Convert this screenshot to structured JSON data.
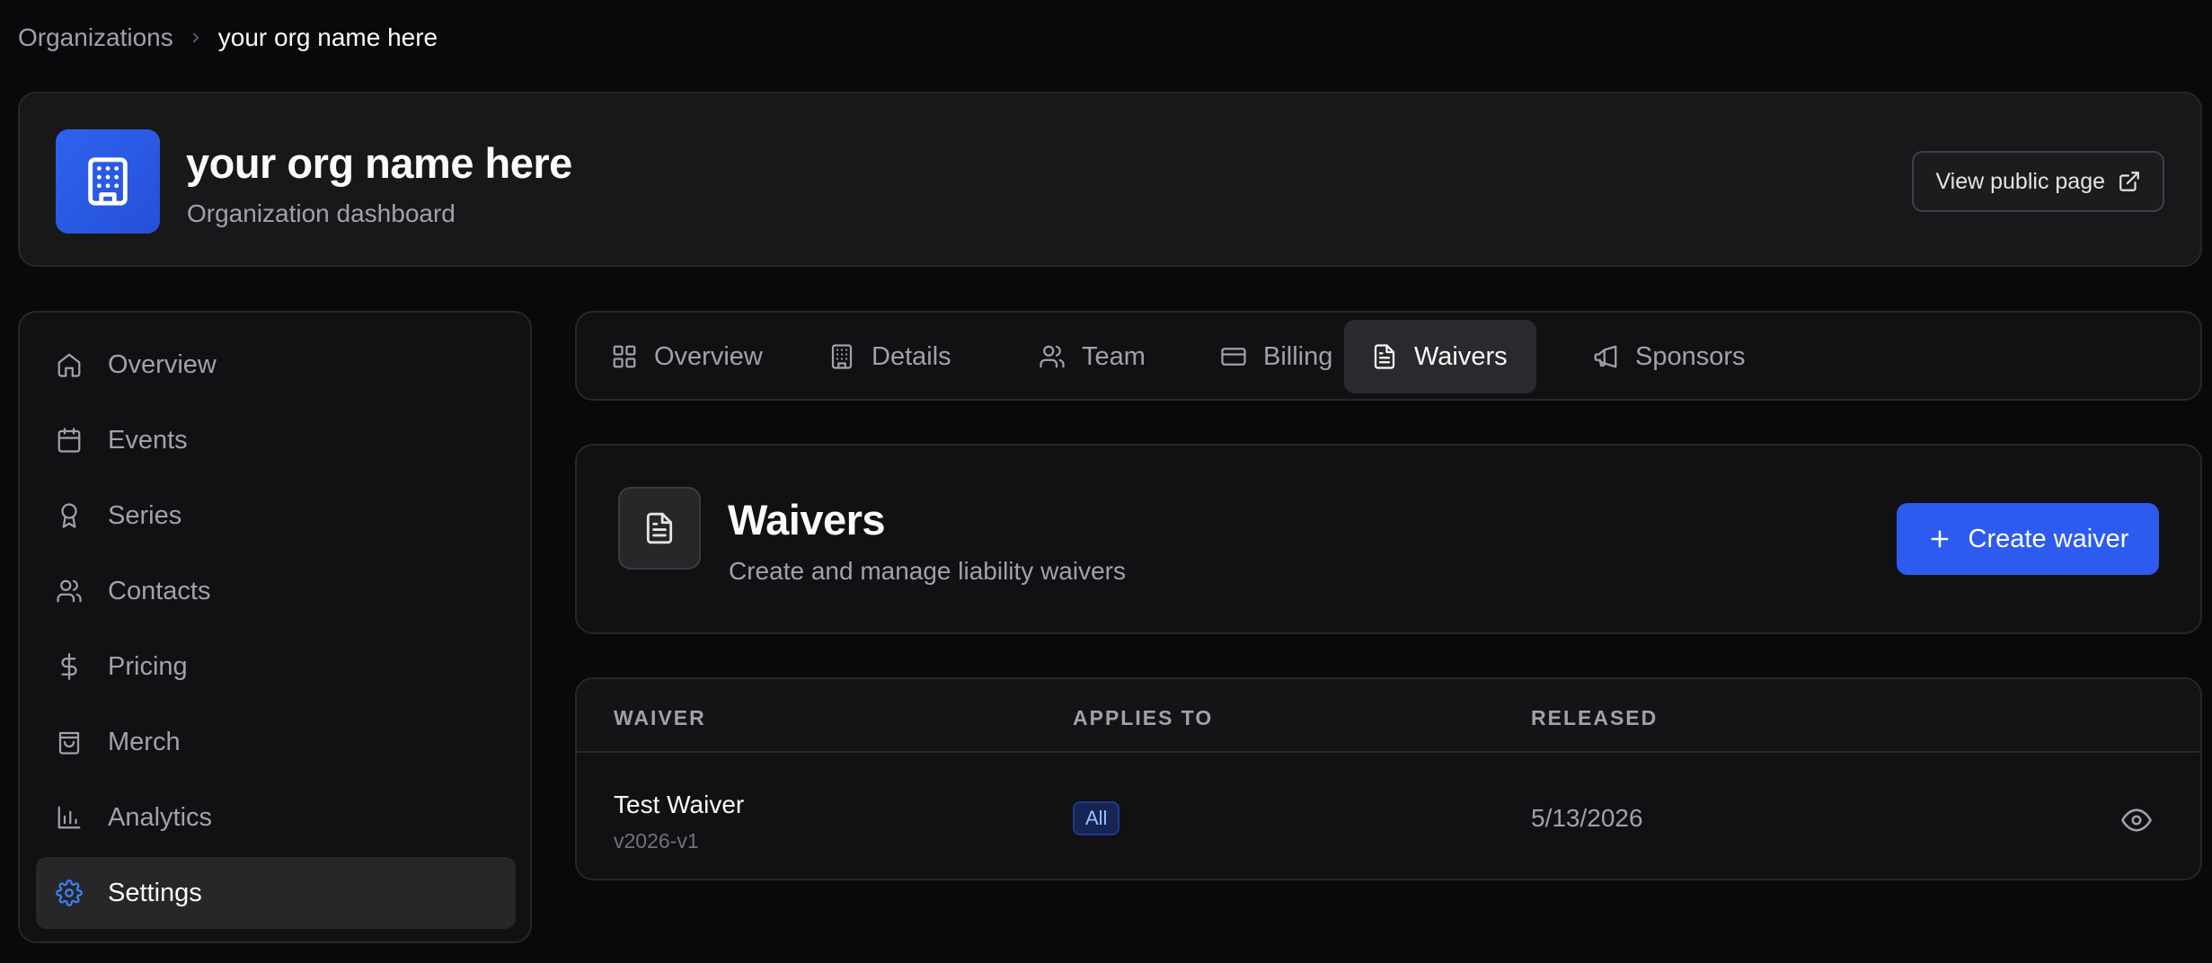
{
  "breadcrumb": {
    "root": "Organizations",
    "current": "your org name here"
  },
  "org": {
    "name": "your org name here",
    "subtitle": "Organization dashboard",
    "public_button": "View public page",
    "logo_icon": "building-icon"
  },
  "sidebar": {
    "items": [
      {
        "label": "Overview",
        "icon": "home-icon"
      },
      {
        "label": "Events",
        "icon": "calendar-icon"
      },
      {
        "label": "Series",
        "icon": "award-icon"
      },
      {
        "label": "Contacts",
        "icon": "users-icon"
      },
      {
        "label": "Pricing",
        "icon": "dollar-icon"
      },
      {
        "label": "Merch",
        "icon": "shopping-bag-icon"
      },
      {
        "label": "Analytics",
        "icon": "bar-chart-icon"
      },
      {
        "label": "Settings",
        "icon": "gear-icon",
        "active": true
      }
    ]
  },
  "tabs": [
    {
      "label": "Overview",
      "icon": "grid-icon"
    },
    {
      "label": "Details",
      "icon": "building-icon"
    },
    {
      "label": "Team",
      "icon": "users-icon"
    },
    {
      "label": "Billing",
      "icon": "credit-card-icon"
    },
    {
      "label": "Waivers",
      "icon": "file-text-icon",
      "active": true
    },
    {
      "label": "Sponsors",
      "icon": "megaphone-icon"
    }
  ],
  "waivers_section": {
    "title": "Waivers",
    "subtitle": "Create and manage liability waivers",
    "create_button": "Create waiver"
  },
  "table": {
    "columns": [
      "WAIVER",
      "APPLIES TO",
      "RELEASED"
    ],
    "rows": [
      {
        "name": "Test Waiver",
        "version": "v2026-v1",
        "applies_to": "All",
        "released": "5/13/2026"
      }
    ]
  },
  "colors": {
    "background": "#09090b",
    "card": "#111113",
    "border": "#27272a",
    "accent": "#2d5bf0",
    "active_icon": "#3b82f6",
    "muted_text": "#a1a1aa"
  }
}
